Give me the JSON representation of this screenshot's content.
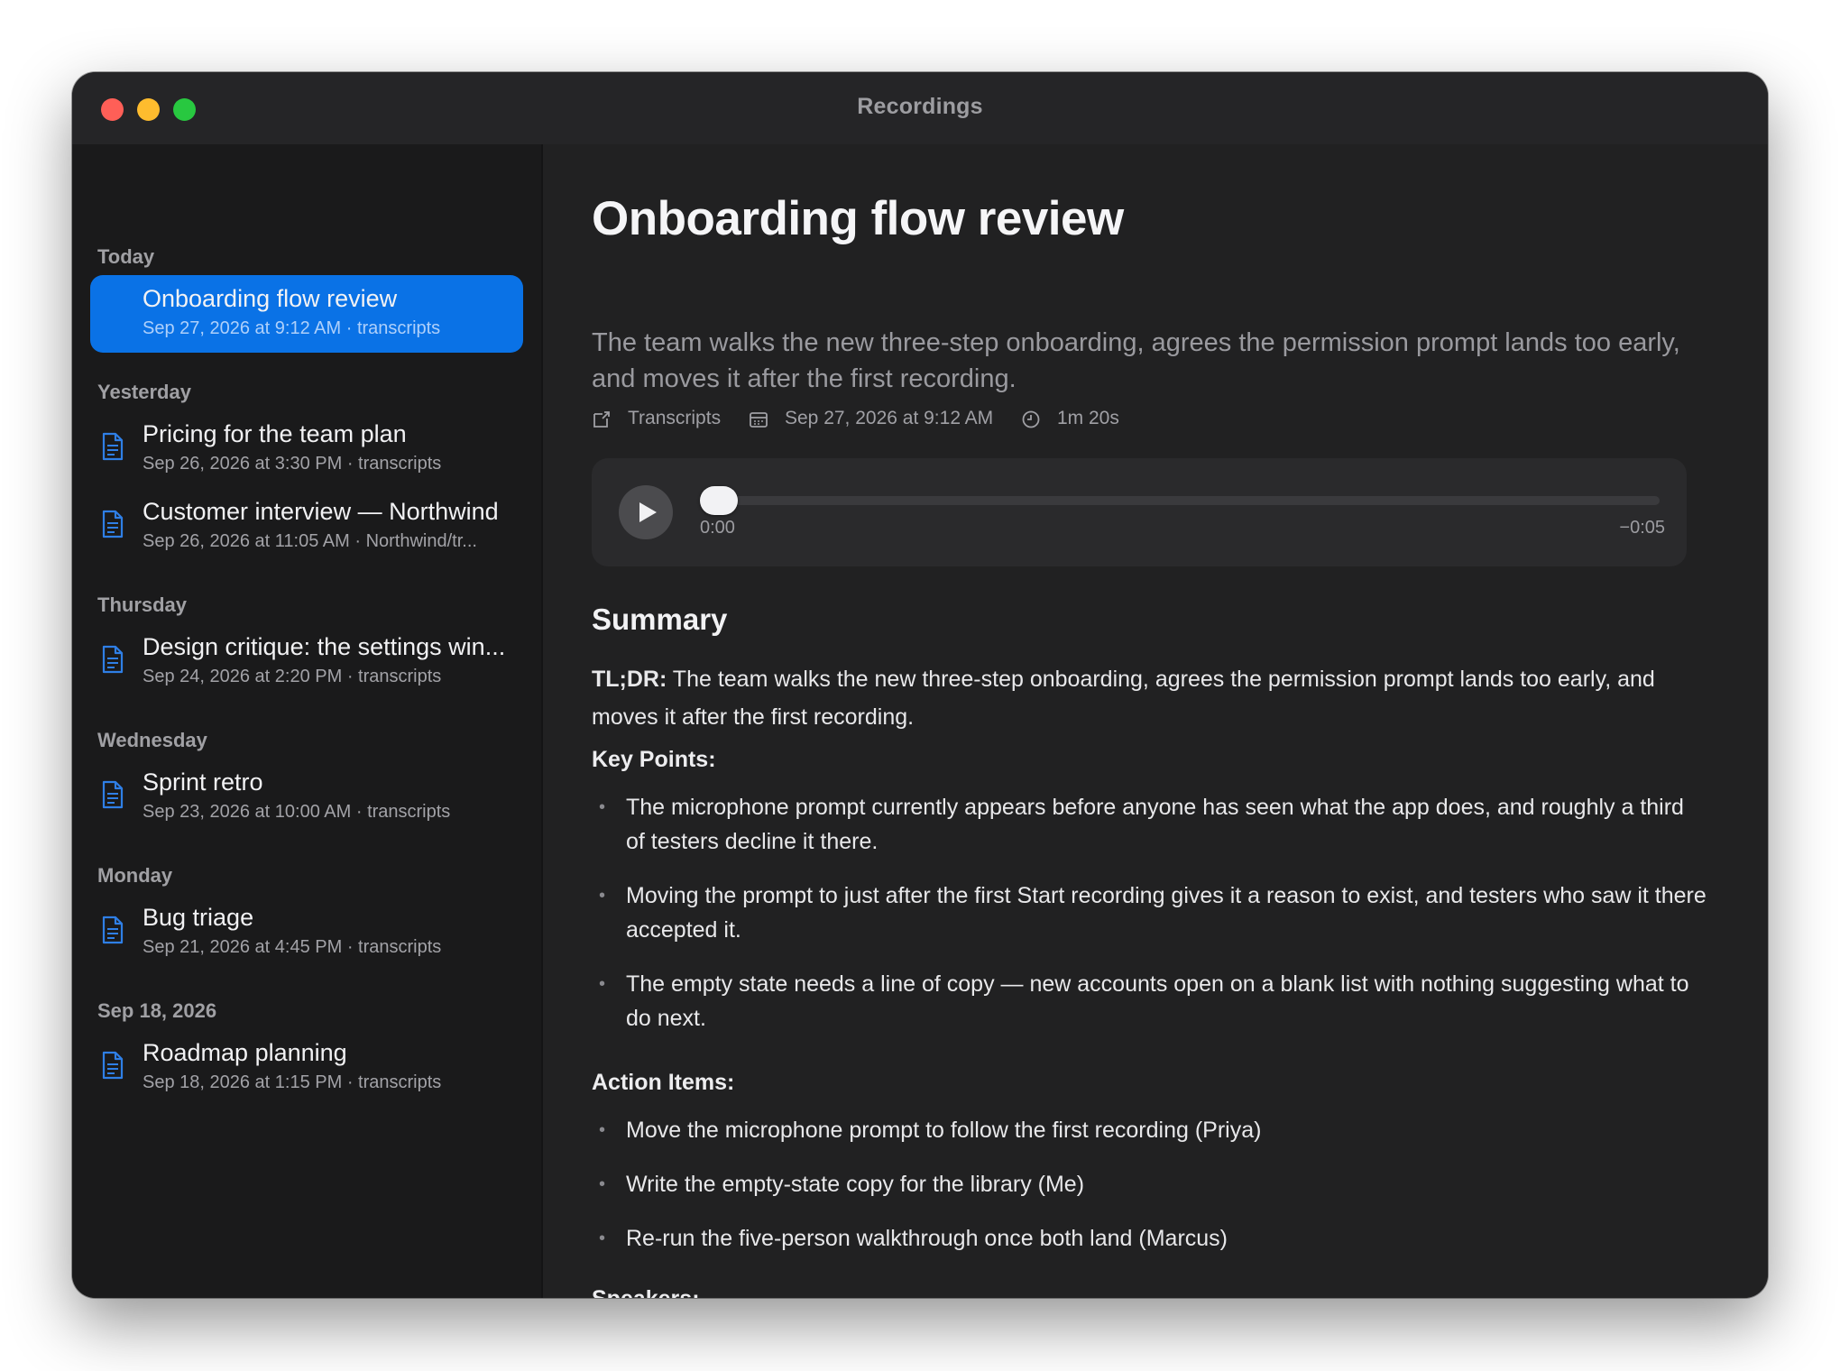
{
  "window": {
    "title": "Recordings"
  },
  "sidebar": {
    "groups": [
      {
        "label": "Today",
        "items": [
          {
            "title": "Onboarding flow review",
            "subtitle": "Sep 27, 2026 at 9:12 AM · transcripts",
            "selected": true
          }
        ]
      },
      {
        "label": "Yesterday",
        "items": [
          {
            "title": "Pricing for the team plan",
            "subtitle": "Sep 26, 2026 at 3:30 PM · transcripts"
          },
          {
            "title": "Customer interview — Northwind",
            "subtitle": "Sep 26, 2026 at 11:05 AM · Northwind/tr..."
          }
        ]
      },
      {
        "label": "Thursday",
        "items": [
          {
            "title": "Design critique: the settings win...",
            "subtitle": "Sep 24, 2026 at 2:20 PM · transcripts"
          }
        ]
      },
      {
        "label": "Wednesday",
        "items": [
          {
            "title": "Sprint retro",
            "subtitle": "Sep 23, 2026 at 10:00 AM · transcripts"
          }
        ]
      },
      {
        "label": "Monday",
        "items": [
          {
            "title": "Bug triage",
            "subtitle": "Sep 21, 2026 at 4:45 PM · transcripts"
          }
        ]
      },
      {
        "label": "Sep 18, 2026",
        "items": [
          {
            "title": "Roadmap planning",
            "subtitle": "Sep 18, 2026 at 1:15 PM · transcripts"
          }
        ]
      }
    ]
  },
  "detail": {
    "title": "Onboarding flow review",
    "description": "The team walks the new three-step onboarding, agrees the permission prompt lands too early, and moves it after the first recording.",
    "meta": {
      "folder": "Transcripts",
      "date": "Sep 27, 2026 at 9:12 AM",
      "duration": "1m 20s"
    },
    "player": {
      "elapsed": "0:00",
      "remaining": "−0:05",
      "progress": 0
    },
    "summary": {
      "heading": "Summary",
      "tldr_label": "TL;DR:",
      "tldr_text": " The team walks the new three-step onboarding, agrees the permission prompt lands too early, and moves it after the first recording.",
      "key_points_label": "Key Points:",
      "key_points": [
        "The microphone prompt currently appears before anyone has seen what the app does, and roughly a third of testers decline it there.",
        "Moving the prompt to just after the first Start recording gives it a reason to exist, and testers who saw it there accepted it.",
        "The empty state needs a line of copy — new accounts open on a blank list with nothing suggesting what to do next."
      ],
      "action_items_label": "Action Items:",
      "action_items": [
        "Move the microphone prompt to follow the first recording (Priya)",
        "Write the empty-state copy for the library (Me)",
        "Re-run the five-person walkthrough once both land (Marcus)"
      ],
      "speakers_label": "Speakers:"
    }
  },
  "colors": {
    "accent": "#0a72e6",
    "close": "#ff5f57",
    "minimize": "#febc2e",
    "zoom": "#28c840",
    "doc_icon": "#2f7fe6"
  }
}
